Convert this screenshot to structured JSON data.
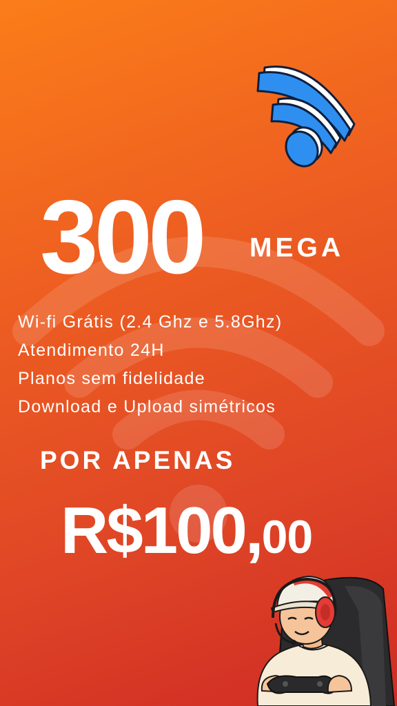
{
  "plan": {
    "speed_number": "300",
    "speed_unit": "MEGA"
  },
  "features": [
    "Wi-fi Grátis (2.4 Ghz e 5.8Ghz)",
    "Atendimento 24H",
    "Planos sem fidelidade",
    "Download e Upload simétricos"
  ],
  "price": {
    "lead": "POR APENAS",
    "main": "R$100,",
    "cents": "00"
  },
  "icons": {
    "top": "wifi-icon",
    "background": "wifi-watermark-icon",
    "illustration": "gamer-with-headset-and-controller"
  },
  "colors": {
    "background_top": "#fb7d19",
    "background_bottom": "#cf2b24",
    "text": "#ffffff",
    "wifi_icon": "#2f8ff0",
    "headset": "#e53b35"
  }
}
